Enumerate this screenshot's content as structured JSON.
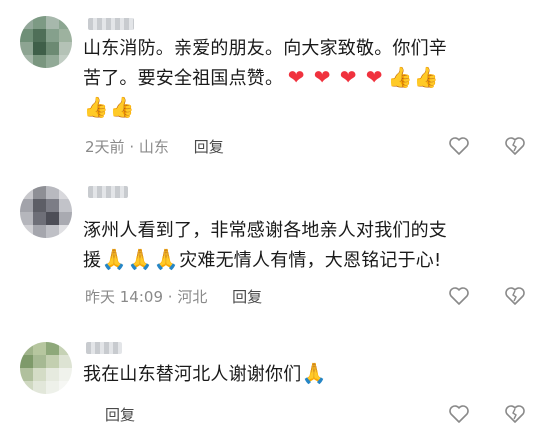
{
  "comments": [
    {
      "username": "••••",
      "text_line1": "山东消防。亲爱的朋友。向大家致敬。你们辛",
      "text_line2": "苦了。要安全祖国点赞。",
      "emoji_row1": [
        "heart",
        "heart",
        "heart",
        "heart",
        "thumbs-up",
        "thumbs-up"
      ],
      "emoji_row2": [
        "thumbs-up",
        "thumbs-up"
      ],
      "time": "2天前",
      "location": "山东",
      "reply_label": "回复"
    },
    {
      "username": "••••",
      "text_line1": "涿州人看到了，非常感谢各地亲人对我们的支",
      "text_line2_prefix": "援",
      "text_line2_suffix": "灾难无情人有情，大恩铭记于心!",
      "emojis": [
        "pray",
        "pray",
        "pray"
      ],
      "time": "昨天 14:09",
      "location": "河北",
      "reply_label": "回复"
    },
    {
      "username": "••••",
      "text_line1": "我在山东替河北人谢谢你们",
      "emojis": [
        "pray"
      ],
      "time": "",
      "location": "",
      "reply_label": "回复"
    }
  ],
  "colors": {
    "heart": "#f0323e",
    "thumbs": "#f5a623",
    "pray": "#f2a541",
    "meta": "#8a8a8a"
  },
  "icons": {
    "like": "heart-outline-icon",
    "dislike": "broken-heart-outline-icon"
  }
}
